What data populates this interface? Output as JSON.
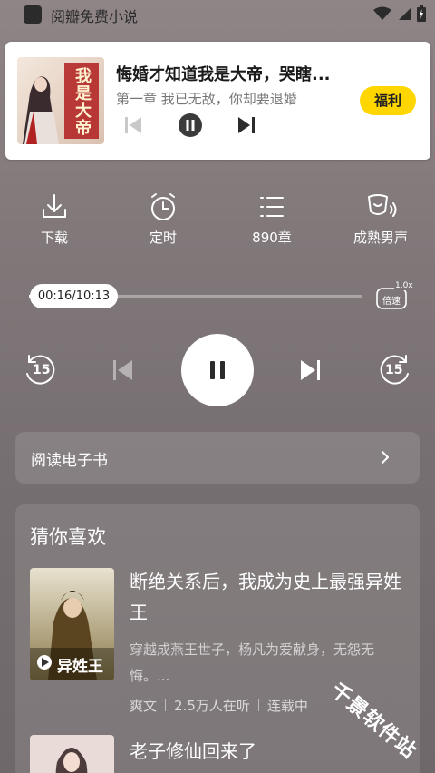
{
  "status": {
    "app_title": "阅瓣免费小说"
  },
  "mini_player": {
    "title": "悔婚才知道我是大帝，哭瞎...",
    "chapter": "第一章 我已无敌，你却要退婚",
    "welfare_button": "福利",
    "cover_text": "我是大帝"
  },
  "features": [
    {
      "label": "下载",
      "icon": "download-icon"
    },
    {
      "label": "定时",
      "icon": "timer-icon"
    },
    {
      "label": "890章",
      "icon": "chapter-list-icon"
    },
    {
      "label": "成熟男声",
      "icon": "voice-icon"
    }
  ],
  "progress": {
    "time": "00:16/10:13",
    "fraction": 0.026,
    "speed_value": "1.0x",
    "speed_label": "倍速"
  },
  "controls": {
    "rewind_label": "15",
    "forward_label": "15"
  },
  "ebook": {
    "label": "阅读电子书"
  },
  "recommend": {
    "heading": "猜你喜欢",
    "books": [
      {
        "title": "断绝关系后，我成为史上最强异姓王",
        "desc": "穿越成燕王世子，杨凡为爱献身，无怨无悔。...",
        "narrator": "爽文",
        "listeners": "2.5万人在听",
        "state": "连载中",
        "cover_text": "异姓王"
      },
      {
        "title": "老子修仙回来了"
      }
    ]
  },
  "watermark": "千景软件站",
  "colors": {
    "accent": "#ffd600",
    "background": "#81787a"
  }
}
